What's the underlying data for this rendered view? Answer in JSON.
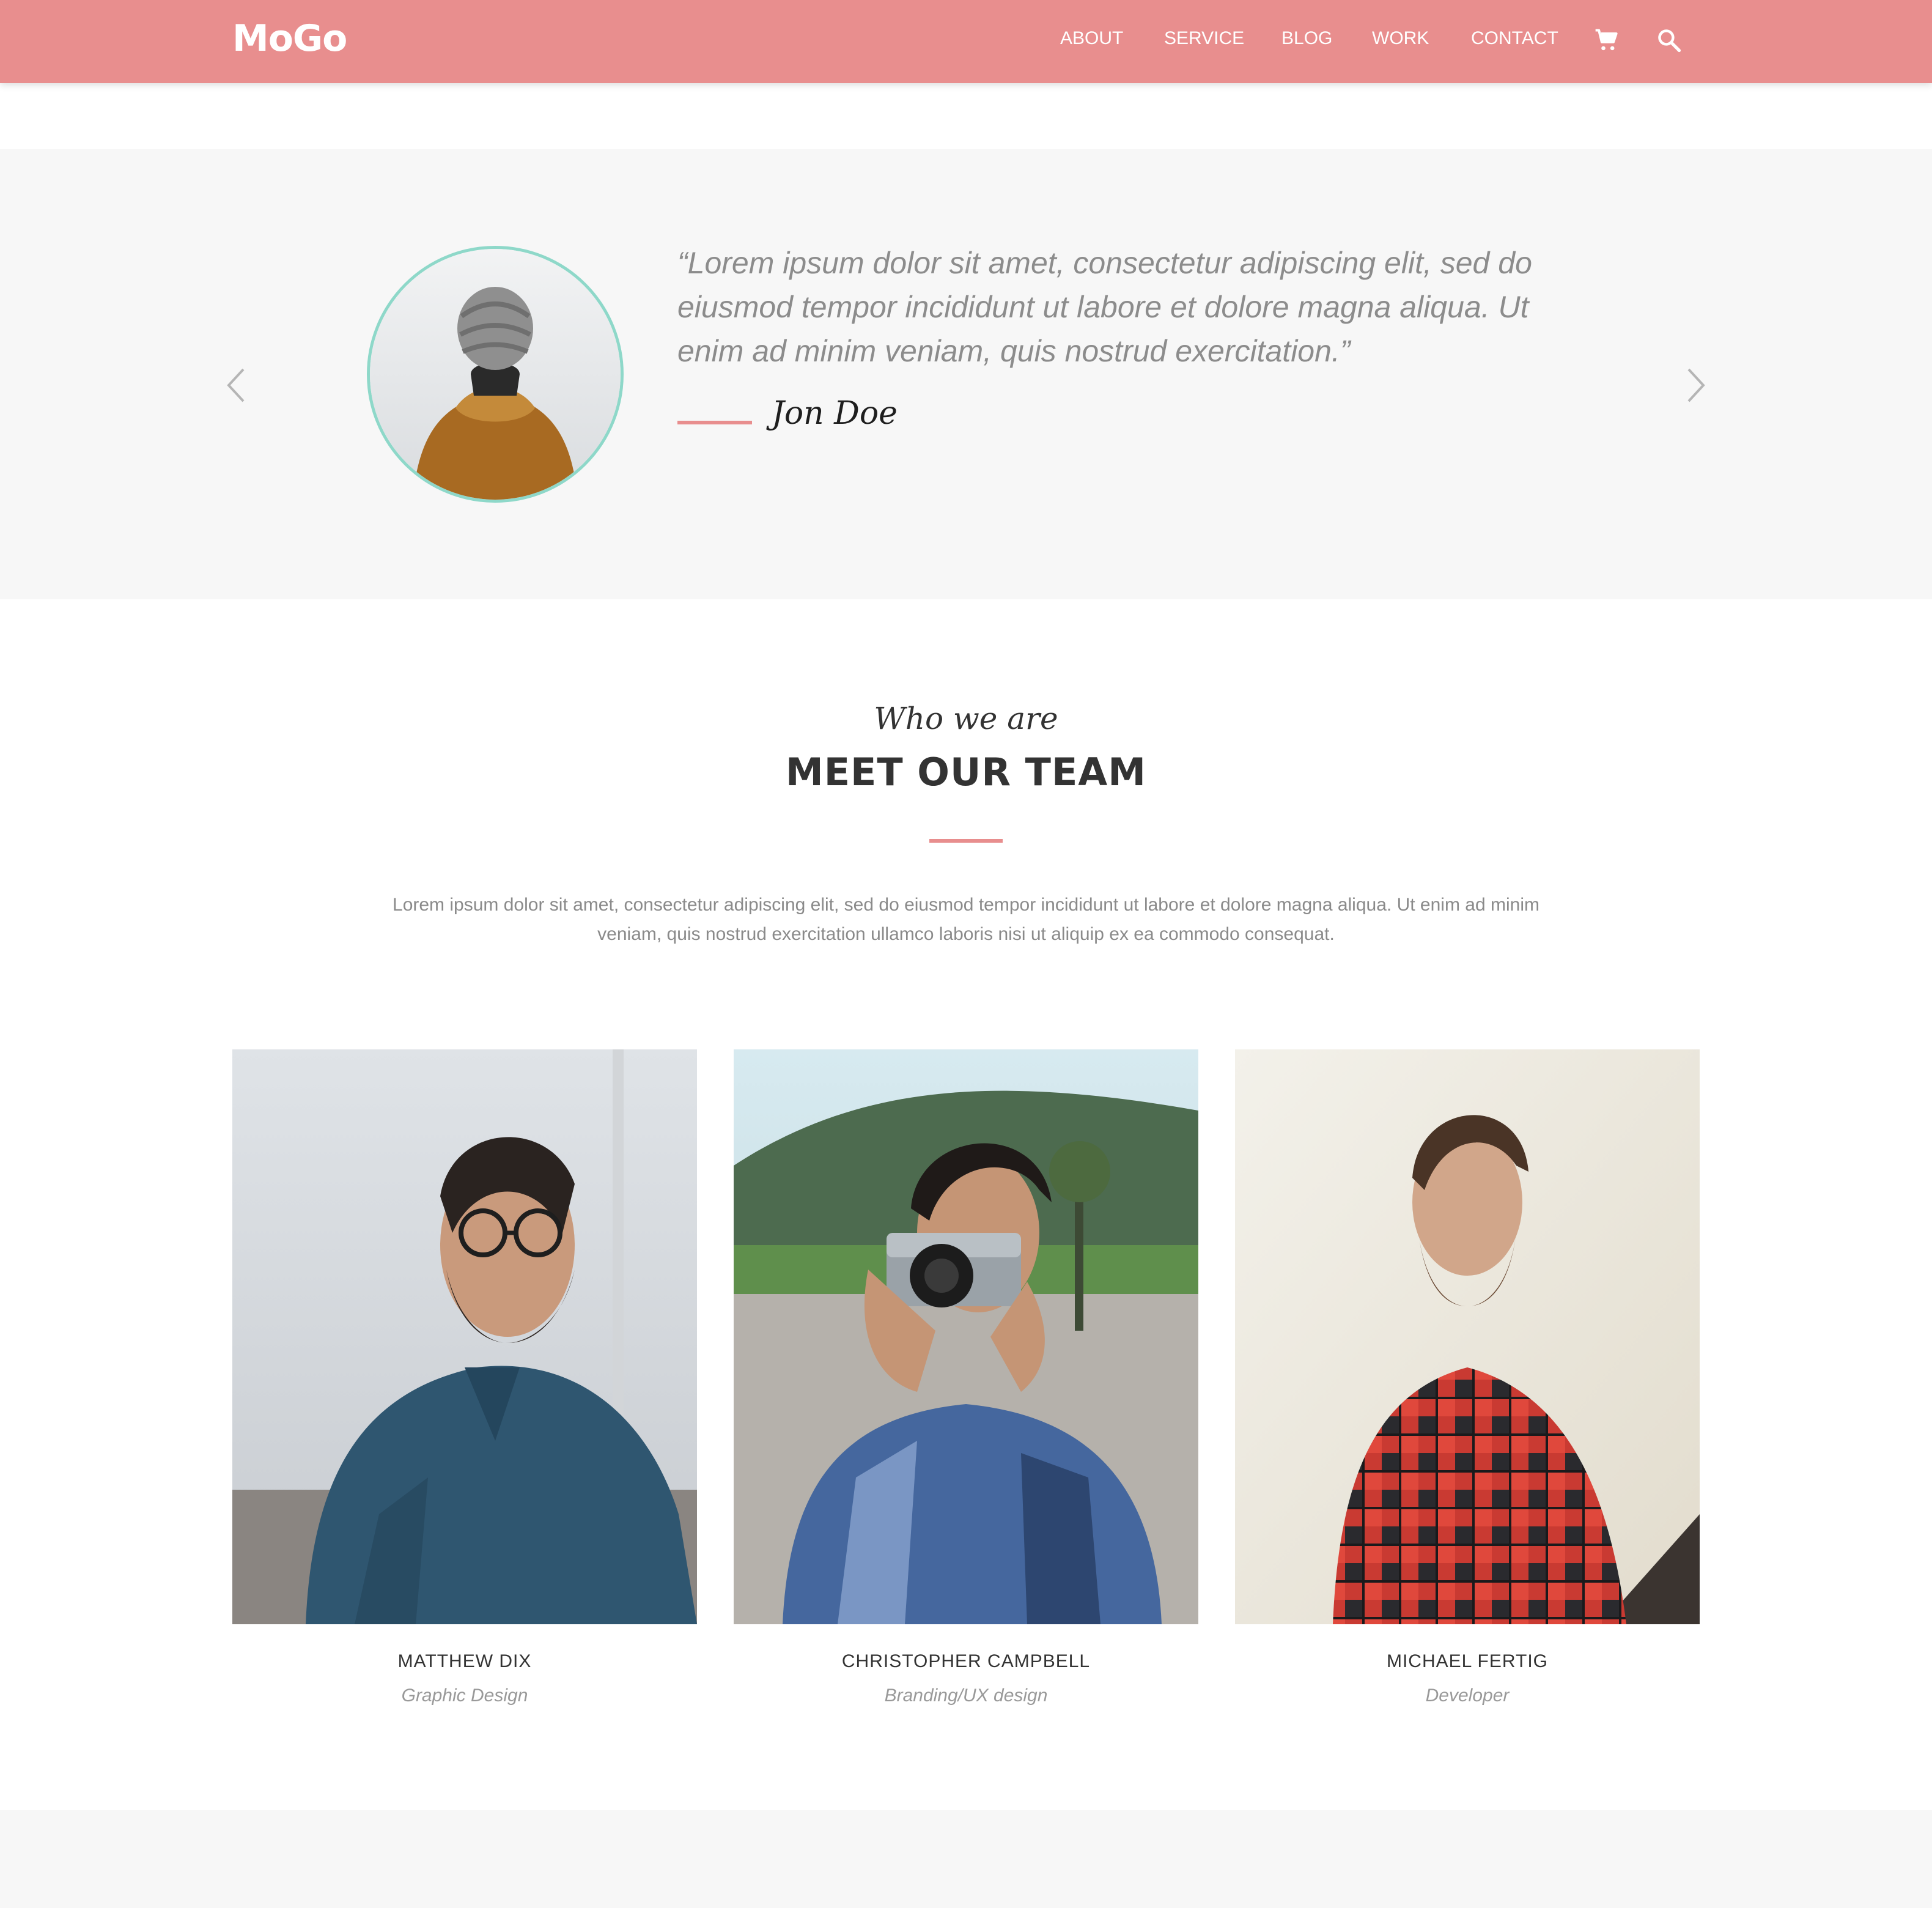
{
  "header": {
    "logo": "MoGo",
    "nav": [
      {
        "label": "ABOUT"
      },
      {
        "label": "SERVICE"
      },
      {
        "label": "BLOG"
      },
      {
        "label": "WORK"
      },
      {
        "label": "CONTACT"
      }
    ],
    "icons": [
      "cart-icon",
      "search-icon"
    ]
  },
  "testimonial": {
    "quote": "“Lorem ipsum dolor sit amet, consectetur adipiscing elit, sed do eiusmod tempor incididunt ut labore et dolore magna aliqua. Ut enim ad minim veniam, quis nostrud exercitation.”",
    "author": "Jon Doe",
    "prev_icon": "chevron-left-icon",
    "next_icon": "chevron-right-icon"
  },
  "team": {
    "subtitle": "Who we are",
    "title": "MEET OUR TEAM",
    "intro": "Lorem ipsum dolor sit amet, consectetur adipiscing elit, sed do eiusmod tempor incididunt ut labore et dolore magna aliqua. Ut enim ad minim veniam, quis nostrud exercitation ullamco laboris nisi ut aliquip ex ea commodo consequat.",
    "members": [
      {
        "name": "MATTHEW DIX",
        "role": "Graphic Design"
      },
      {
        "name": "CHRISTOPHER CAMPBELL",
        "role": "Branding/UX design"
      },
      {
        "name": "MICHAEL FERTIG",
        "role": "Developer"
      }
    ]
  },
  "colors": {
    "brand": "#e88e8e",
    "accent_teal": "#8ed8c9",
    "section_bg": "#f7f7f7"
  }
}
